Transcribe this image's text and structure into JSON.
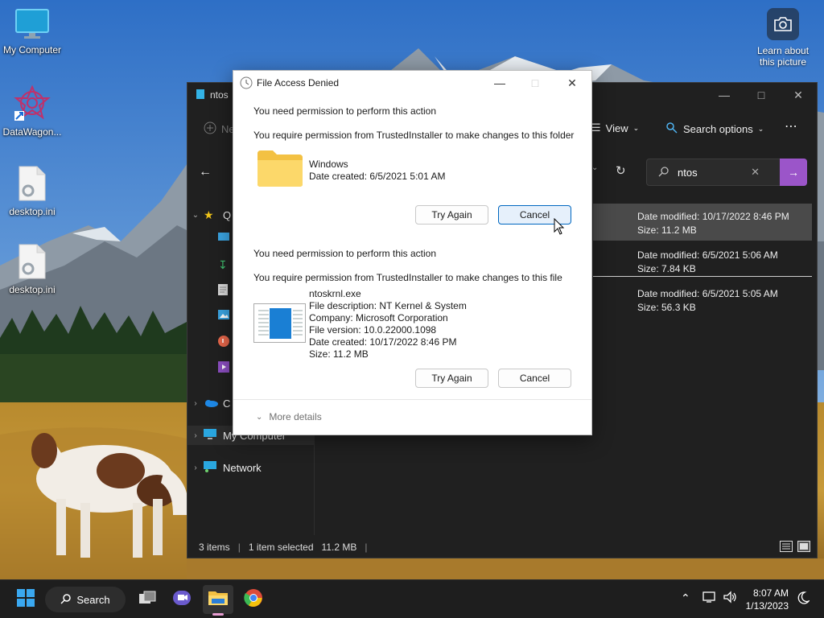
{
  "desktop": {
    "icons": [
      {
        "label": "My Computer"
      },
      {
        "label": "DataWagon..."
      },
      {
        "label": "desktop.ini"
      },
      {
        "label": "desktop.ini"
      }
    ],
    "learn_about": "Learn about this picture"
  },
  "explorer": {
    "tab_title": "ntos",
    "toolbar": {
      "new_label": "Ne",
      "view_label": "View",
      "search_options_label": "Search options"
    },
    "search_value": "ntos",
    "nav": [
      {
        "label": "Q",
        "icon": "star-icon"
      },
      {
        "label": "C",
        "icon": "onedrive-icon"
      },
      {
        "label": "My Computer",
        "icon": "computer-icon"
      },
      {
        "label": "Network",
        "icon": "network-icon"
      }
    ],
    "results": [
      {
        "modified": "Date modified: 10/17/2022 8:46 PM",
        "size": "Size: 11.2 MB"
      },
      {
        "modified": "Date modified: 6/5/2021 5:06 AM",
        "size": "Size: 7.84 KB"
      },
      {
        "modified": "Date modified: 6/5/2021 5:05 AM",
        "size": "Size: 56.3 KB"
      }
    ],
    "status": {
      "items": "3 items",
      "selected": "1 item selected",
      "size": "11.2 MB"
    }
  },
  "dialog": {
    "title": "File Access Denied",
    "section1": {
      "heading": "You need permission to perform this action",
      "detail": "You require permission from TrustedInstaller to make changes to this folder",
      "name": "Windows",
      "created": "Date created: 6/5/2021 5:01 AM",
      "try_again": "Try Again",
      "cancel": "Cancel"
    },
    "section2": {
      "heading": "You need permission to perform this action",
      "detail": "You require permission from TrustedInstaller to make changes to this file",
      "name": "ntoskrnl.exe",
      "description": "File description: NT Kernel & System",
      "company": "Company: Microsoft Corporation",
      "version": "File version: 10.0.22000.1098",
      "created": "Date created: 10/17/2022 8:46 PM",
      "size": "Size: 11.2 MB",
      "try_again": "Try Again",
      "cancel": "Cancel"
    },
    "more_details": "More details"
  },
  "taskbar": {
    "search_label": "Search",
    "time": "8:07 AM",
    "date": "1/13/2023"
  }
}
